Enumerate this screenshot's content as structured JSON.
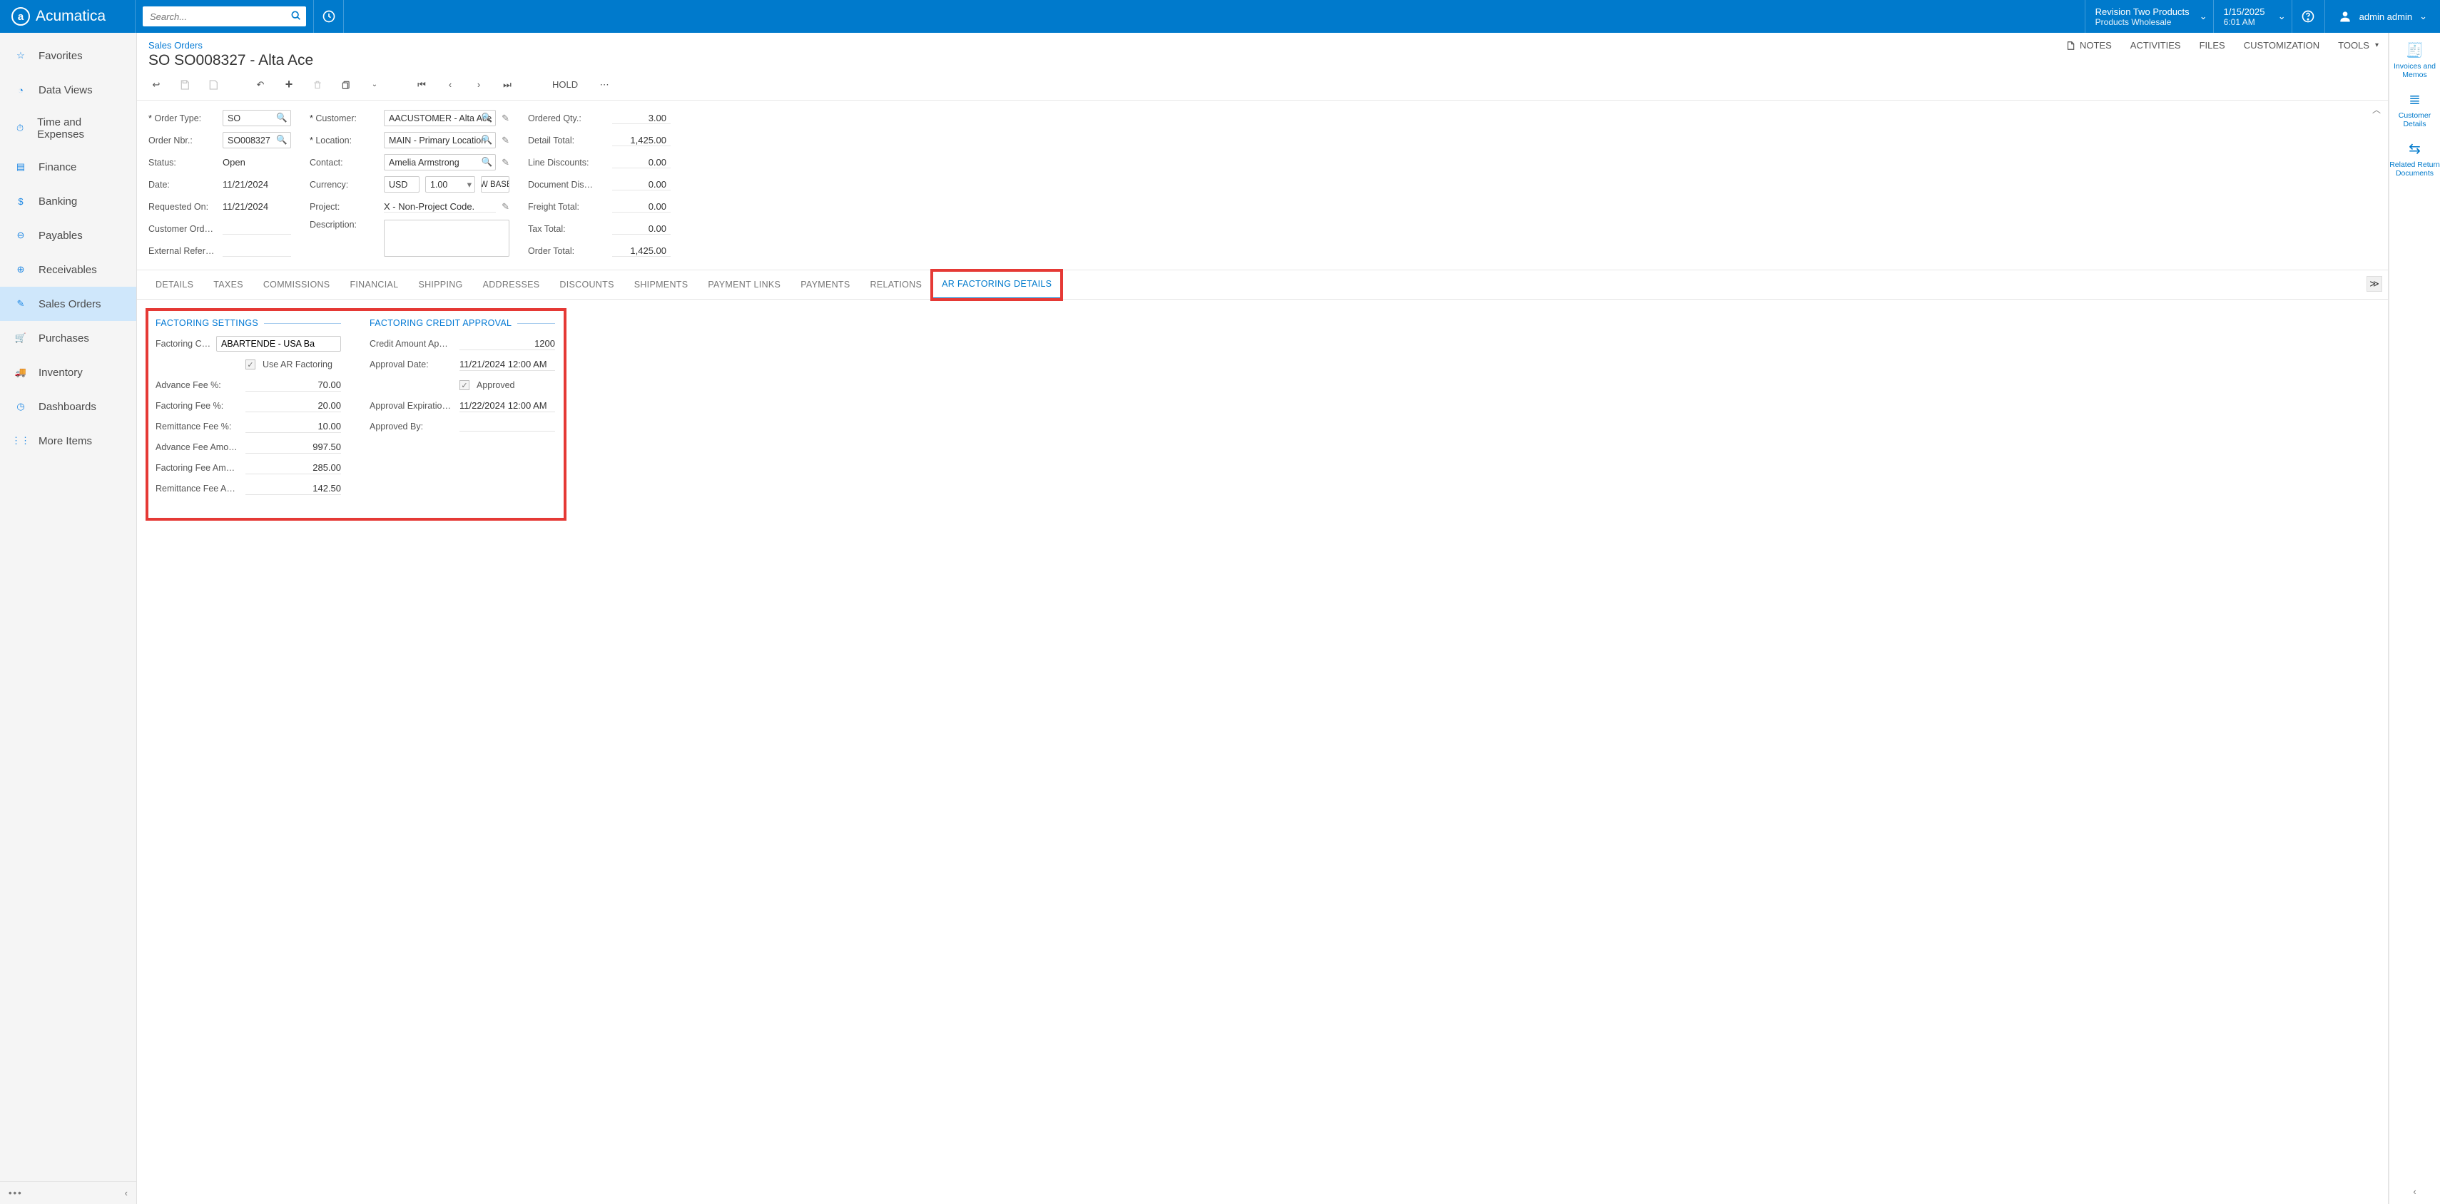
{
  "brand": "Acumatica",
  "search": {
    "placeholder": "Search..."
  },
  "tenant": {
    "line1": "Revision Two Products",
    "line2": "Products Wholesale"
  },
  "datetime": {
    "line1": "1/15/2025",
    "line2": "6:01 AM"
  },
  "user": {
    "name": "admin admin"
  },
  "leftnav": {
    "items": [
      {
        "label": "Favorites"
      },
      {
        "label": "Data Views"
      },
      {
        "label": "Time and Expenses"
      },
      {
        "label": "Finance"
      },
      {
        "label": "Banking"
      },
      {
        "label": "Payables"
      },
      {
        "label": "Receivables"
      },
      {
        "label": "Sales Orders"
      },
      {
        "label": "Purchases"
      },
      {
        "label": "Inventory"
      },
      {
        "label": "Dashboards"
      },
      {
        "label": "More Items"
      }
    ],
    "active_index": 7
  },
  "header": {
    "breadcrumb": "Sales Orders",
    "title": "SO SO008327 - Alta Ace",
    "actions": {
      "notes": "NOTES",
      "activities": "ACTIVITIES",
      "files": "FILES",
      "customization": "CUSTOMIZATION",
      "tools": "TOOLS"
    }
  },
  "toolbar": {
    "hold": "HOLD"
  },
  "form": {
    "order_type": {
      "label": "Order Type:",
      "value": "SO"
    },
    "order_nbr": {
      "label": "Order Nbr.:",
      "value": "SO008327"
    },
    "status": {
      "label": "Status:",
      "value": "Open"
    },
    "date": {
      "label": "Date:",
      "value": "11/21/2024"
    },
    "requested_on": {
      "label": "Requested On:",
      "value": "11/21/2024"
    },
    "customer_ord": {
      "label": "Customer Ord…",
      "value": ""
    },
    "external_ref": {
      "label": "External Refer…",
      "value": ""
    },
    "customer": {
      "label": "Customer:",
      "value": "AACUSTOMER - Alta Ace"
    },
    "location": {
      "label": "Location:",
      "value": "MAIN - Primary Location"
    },
    "contact": {
      "label": "Contact:",
      "value": "Amelia Armstrong"
    },
    "currency": {
      "label": "Currency:",
      "cur": "USD",
      "rate": "1.00",
      "view_base": "VIEW BASE"
    },
    "project": {
      "label": "Project:",
      "value": "X - Non-Project Code."
    },
    "description": {
      "label": "Description:",
      "value": ""
    },
    "ordered_qty": {
      "label": "Ordered Qty.:",
      "value": "3.00"
    },
    "detail_total": {
      "label": "Detail Total:",
      "value": "1,425.00"
    },
    "line_discounts": {
      "label": "Line Discounts:",
      "value": "0.00"
    },
    "document_disc": {
      "label": "Document Dis…",
      "value": "0.00"
    },
    "freight_total": {
      "label": "Freight Total:",
      "value": "0.00"
    },
    "tax_total": {
      "label": "Tax Total:",
      "value": "0.00"
    },
    "order_total": {
      "label": "Order Total:",
      "value": "1,425.00"
    }
  },
  "tabs": [
    "DETAILS",
    "TAXES",
    "COMMISSIONS",
    "FINANCIAL",
    "SHIPPING",
    "ADDRESSES",
    "DISCOUNTS",
    "SHIPMENTS",
    "PAYMENT LINKS",
    "PAYMENTS",
    "RELATIONS",
    "AR FACTORING DETAILS"
  ],
  "active_tab_index": 11,
  "factoring": {
    "settings_title": "FACTORING SETTINGS",
    "company_label": "Factoring Company:",
    "company": "ABARTENDE - USA Ba",
    "use_ar_factoring": "Use AR Factoring",
    "advance_fee_pct_label": "Advance Fee %:",
    "advance_fee_pct": "70.00",
    "factoring_fee_pct_label": "Factoring Fee %:",
    "factoring_fee_pct": "20.00",
    "remittance_fee_pct_label": "Remittance Fee %:",
    "remittance_fee_pct": "10.00",
    "advance_fee_amt_label": "Advance Fee Amo…",
    "advance_fee_amt": "997.50",
    "factoring_fee_amt_label": "Factoring Fee Am…",
    "factoring_fee_amt": "285.00",
    "remittance_fee_amt_label": "Remittance Fee A…",
    "remittance_fee_amt": "142.50",
    "approval_title": "FACTORING CREDIT APPROVAL",
    "credit_amount_label": "Credit Amount Ap…",
    "credit_amount": "1200",
    "approval_date_label": "Approval Date:",
    "approval_date": "11/21/2024 12:00 AM",
    "approved_label": "Approved",
    "approval_exp_label": "Approval Expiratio…",
    "approval_exp": "11/22/2024 12:00 AM",
    "approved_by_label": "Approved By:",
    "approved_by": ""
  },
  "siderail": {
    "items": [
      {
        "label": "Invoices and Memos"
      },
      {
        "label": "Customer Details"
      },
      {
        "label": "Related Return Documents"
      }
    ]
  }
}
